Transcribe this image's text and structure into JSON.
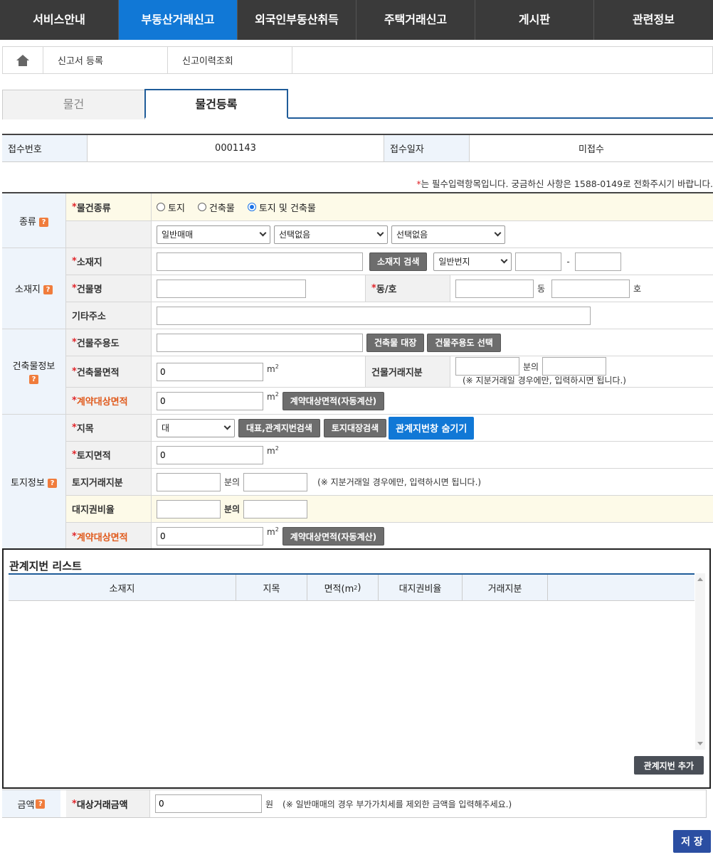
{
  "nav": {
    "items": [
      "서비스안내",
      "부동산거래신고",
      "외국인부동산취득",
      "주택거래신고",
      "게시판",
      "관련정보"
    ],
    "active": "부동산거래신고"
  },
  "submenu": {
    "items": [
      "신고서 등록",
      "신고이력조회"
    ]
  },
  "tabs": {
    "items": [
      "물건",
      "물건등록"
    ],
    "active": "물건등록"
  },
  "receipt": {
    "no_label": "접수번호",
    "no_value": "0001143",
    "date_label": "접수일자",
    "date_value": "미접수"
  },
  "notice": {
    "mark": "*",
    "text": "는 필수입력항목입니다. 궁금하신 사항은 1588-0149로 전화주시기 바랍니다."
  },
  "type_section": {
    "label": "종류",
    "field_label": "물건종류",
    "radios": [
      {
        "label": "토지",
        "checked": false
      },
      {
        "label": "건축물",
        "checked": false
      },
      {
        "label": "토지 및 건축물",
        "checked": true
      }
    ],
    "selects": [
      "일반매매",
      "선택없음",
      "선택없음"
    ]
  },
  "location_section": {
    "label": "소재지",
    "address_label": "소재지",
    "address_search_button": "소재지 검색",
    "lot_type_select": "일반번지",
    "dash": "-",
    "building_name_label": "건물명",
    "dong_ho_label": "동/호",
    "dong_unit": "동",
    "ho_unit": "호",
    "etc_address_label": "기타주소"
  },
  "building_section": {
    "label": "건축물정보",
    "use_label": "건물주용도",
    "register_button": "건축물 대장",
    "use_select_button": "건물주용도 선택",
    "area_label": "건축물면적",
    "area_value": "0",
    "unit": "m",
    "unit_exp": "2",
    "share_label": "건물거래지분",
    "share_of": "분의",
    "share_hint": "(※ 지분거래일 경우에만, 입력하시면 됩니다.)",
    "contract_area_label": "계약대상면적",
    "contract_area_value": "0",
    "auto_calc_button": "계약대상면적(자동계산)"
  },
  "land_section": {
    "label": "토지정보",
    "category_label": "지목",
    "category_select": "대",
    "rep_search_button": "대표,관계지번검색",
    "land_register_button": "토지대장검색",
    "hide_button": "관계지번창 숨기기",
    "land_area_label": "토지면적",
    "land_area_value": "0",
    "unit": "m",
    "unit_exp": "2",
    "share_label": "토지거래지분",
    "share_of": "분의",
    "share_hint": "(※ 지분거래일 경우에만, 입력하시면 됩니다.)",
    "land_right_label": "대지권비율",
    "land_right_of": "분의",
    "contract_area_label": "계약대상면적",
    "contract_area_value": "0",
    "auto_calc_button": "계약대상면적(자동계산)"
  },
  "related_list": {
    "title": "관계지번 리스트",
    "columns": [
      "소재지",
      "지목",
      "면적(m",
      "대지권비율",
      "거래지분"
    ],
    "area_col_sup": "2",
    "area_col_close": ")",
    "add_button": "관계지번 추가"
  },
  "amount": {
    "label": "금액",
    "field_label": "대상거래금액",
    "value": "0",
    "unit": "원",
    "hint": "(※ 일반매매의 경우 부가가치세를 제외한 금액을 입력해주세요.)"
  },
  "save_button": "저 장",
  "colors": {
    "nav_bg": "#3a3a3a",
    "nav_active": "#1178d6",
    "required": "#e0262b",
    "label_orange": "#e05a1c",
    "save": "#2b4ea2"
  }
}
